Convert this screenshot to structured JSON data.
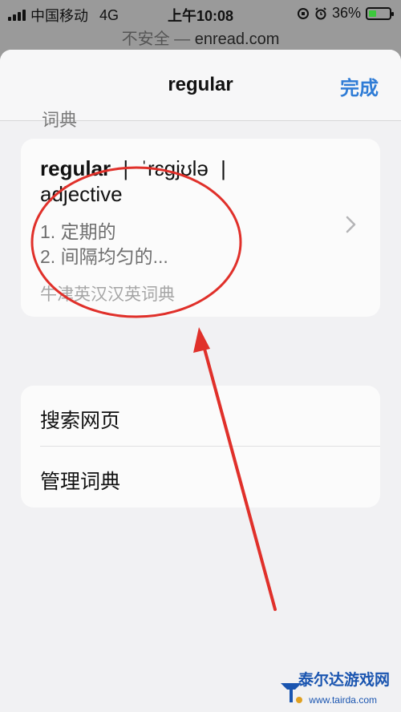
{
  "status": {
    "carrier": "中国移动",
    "network": "4G",
    "time": "上午10:08",
    "battery": "36%",
    "battery_level": 0.36,
    "battery_color": "#3cc83c"
  },
  "urlbar": {
    "insecure_label": "不安全 —",
    "domain": "enread.com"
  },
  "sheet": {
    "title": "regular",
    "done_label": "完成",
    "section_label": "词典"
  },
  "dictionary": {
    "word": "regular",
    "separator_1": "|",
    "pronunciation": "ˈrɛɡjʊlə",
    "separator_2": "|",
    "part_of_speech": "adjective",
    "definitions": [
      "1. 定期的",
      "2. 间隔均匀的..."
    ],
    "source": "牛津英汉汉英词典"
  },
  "actions": [
    {
      "label": "搜索网页"
    },
    {
      "label": "管理词典"
    }
  ],
  "watermark": {
    "text": "泰尔达游戏网",
    "url": "www.tairda.com"
  },
  "colors": {
    "accent": "#2f7cd6",
    "annotation": "#e0302a"
  }
}
